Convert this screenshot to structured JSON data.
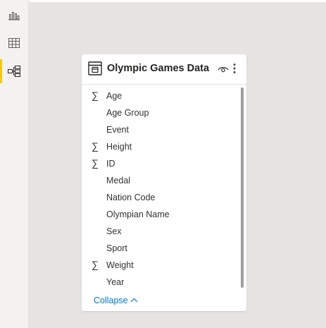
{
  "sidebar": {
    "items": [
      {
        "name": "report-view",
        "icon": "bar-chart-icon",
        "active": false
      },
      {
        "name": "data-view",
        "icon": "table-grid-icon",
        "active": false
      },
      {
        "name": "model-view",
        "icon": "model-icon",
        "active": true
      }
    ],
    "accent": "#f2c811"
  },
  "table_card": {
    "title": "Olympic Games Data",
    "icon": "table-icon",
    "fields": [
      {
        "label": "Age",
        "aggregate": true
      },
      {
        "label": "Age Group",
        "aggregate": false
      },
      {
        "label": "Event",
        "aggregate": false
      },
      {
        "label": "Height",
        "aggregate": true
      },
      {
        "label": "ID",
        "aggregate": true
      },
      {
        "label": "Medal",
        "aggregate": false
      },
      {
        "label": "Nation Code",
        "aggregate": false
      },
      {
        "label": "Olympian Name",
        "aggregate": false
      },
      {
        "label": "Sex",
        "aggregate": false
      },
      {
        "label": "Sport",
        "aggregate": false
      },
      {
        "label": "Weight",
        "aggregate": true
      },
      {
        "label": "Year",
        "aggregate": false
      }
    ],
    "sigma_symbol": "∑",
    "collapse_label": "Collapse"
  },
  "colors": {
    "canvas": "#e5e4e3",
    "link": "#0078d4"
  }
}
